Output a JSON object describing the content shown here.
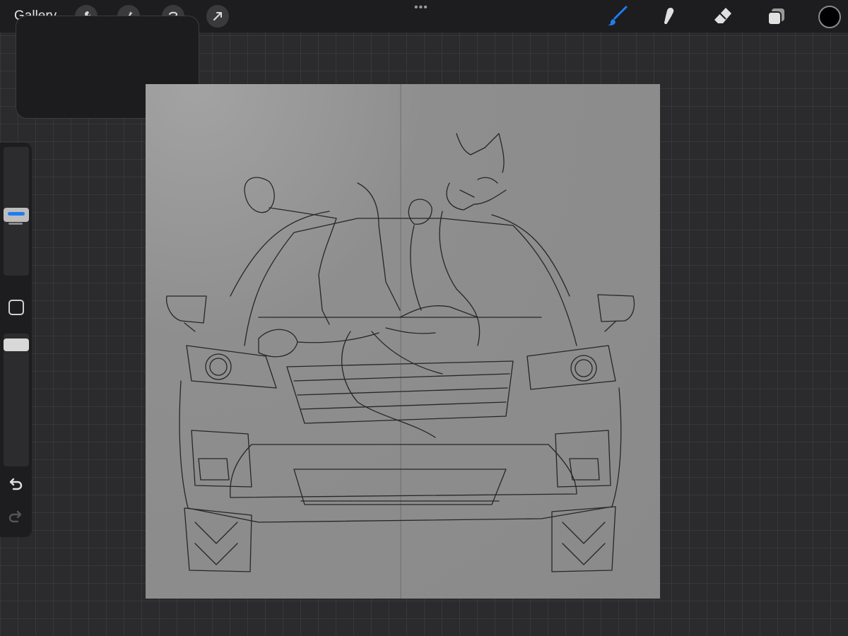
{
  "toolbar": {
    "gallery_label": "Gallery",
    "left_tools": [
      {
        "name": "actions",
        "icon": "wrench-icon"
      },
      {
        "name": "adjustments",
        "icon": "magic-wand-icon"
      },
      {
        "name": "selection",
        "icon": "selection-icon"
      },
      {
        "name": "transform",
        "icon": "arrow-icon"
      }
    ],
    "more_menu": "•••",
    "right_tools": [
      {
        "name": "brush",
        "icon": "brush-icon",
        "active": true
      },
      {
        "name": "smudge",
        "icon": "smudge-icon",
        "active": false
      },
      {
        "name": "eraser",
        "icon": "eraser-icon",
        "active": false
      },
      {
        "name": "layers",
        "icon": "layers-icon",
        "active": false
      }
    ],
    "current_color": "#000000",
    "active_color": "#1e7cf2"
  },
  "sidebar": {
    "size_slider_value": 0.45,
    "opacity_slider_value": 1.0,
    "undo_icon": "undo-icon",
    "redo_icon": "redo-icon"
  },
  "canvas": {
    "background": "#8d8d8d",
    "symmetry_guide": "vertical"
  }
}
